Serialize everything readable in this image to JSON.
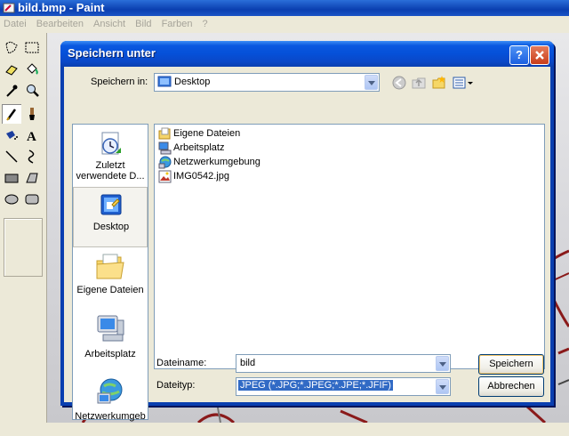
{
  "paint": {
    "title": "bild.bmp - Paint",
    "menu": [
      "Datei",
      "Bearbeiten",
      "Ansicht",
      "Bild",
      "Farben",
      "?"
    ],
    "tools": [
      "free-select-icon",
      "rect-select-icon",
      "eraser-icon",
      "fill-icon",
      "picker-icon",
      "magnifier-icon",
      "pencil-icon",
      "brush-icon",
      "airbrush-icon",
      "text-icon",
      "line-icon",
      "curve-icon",
      "rectangle-icon",
      "polygon-icon",
      "ellipse-icon",
      "rounded-rect-icon"
    ],
    "active_tool": "pencil-icon"
  },
  "dialog": {
    "title": "Speichern unter",
    "help_label": "?",
    "save_in_label": "Speichern in:",
    "save_in_value": "Desktop",
    "places": [
      {
        "label": "Zuletzt verwendete D...",
        "icon": "recent-icon"
      },
      {
        "label": "Desktop",
        "icon": "desktop-icon"
      },
      {
        "label": "Eigene Dateien",
        "icon": "my-documents-icon"
      },
      {
        "label": "Arbeitsplatz",
        "icon": "my-computer-icon"
      },
      {
        "label": "Netzwerkumgeb",
        "icon": "network-icon"
      }
    ],
    "files": [
      {
        "name": "Eigene Dateien",
        "icon": "folder-icon"
      },
      {
        "name": "Arbeitsplatz",
        "icon": "computer-icon"
      },
      {
        "name": "Netzwerkumgebung",
        "icon": "network-icon"
      },
      {
        "name": "IMG0542.jpg",
        "icon": "image-icon"
      }
    ],
    "filename_label": "Dateiname:",
    "filename_value": "bild",
    "filetype_label": "Dateityp:",
    "filetype_value": "JPEG (*.JPG;*.JPEG;*.JPE;*.JFIF)",
    "save_button": "Speichern",
    "cancel_button": "Abbrechen"
  }
}
